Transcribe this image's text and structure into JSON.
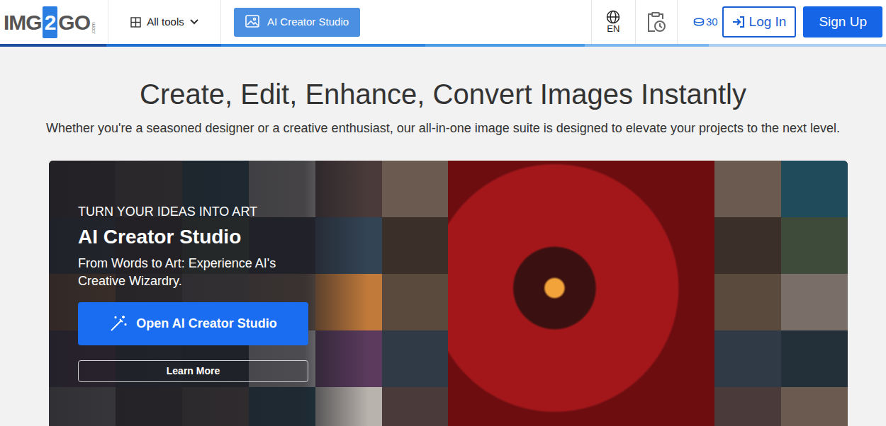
{
  "header": {
    "logo": {
      "prefix": "IMG",
      "digit": "2",
      "suffix": "GO",
      "tld": ".com"
    },
    "all_tools": "All tools",
    "ai_button": "AI Creator Studio",
    "language": "EN",
    "credits": "30",
    "login": "Log In",
    "signup": "Sign Up"
  },
  "hero": {
    "title": "Create, Edit, Enhance, Convert Images Instantly",
    "subtitle": "Whether you're a seasoned designer or a creative enthusiast, our all-in-one image suite is designed to elevate your projects to the next level."
  },
  "banner": {
    "eyebrow": "TURN YOUR IDEAS INTO ART",
    "title": "AI Creator Studio",
    "text": "From Words to Art: Experience AI's Creative Wizardry.",
    "primary_button": "Open AI Creator Studio",
    "secondary_button": "Learn More"
  }
}
